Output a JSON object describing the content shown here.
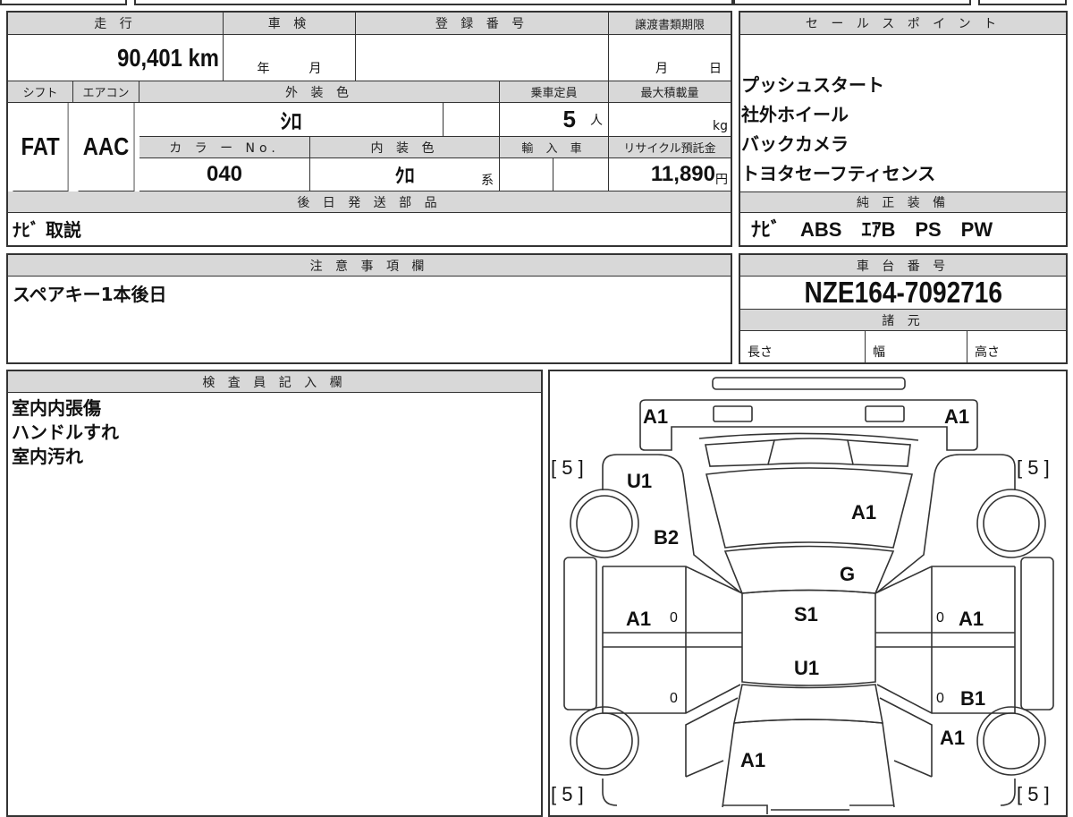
{
  "main_table": {
    "mileage_label": "走 行",
    "mileage_value": "90,401 km",
    "inspection_label": "車 検",
    "inspection_year_unit": "年",
    "inspection_month_unit": "月",
    "registration_label": "登 録 番 号",
    "transfer_deadline_label": "譲渡書類期限",
    "transfer_month_unit": "月",
    "transfer_day_unit": "日",
    "shift_label": "シフト",
    "shift_value": "FAT",
    "aircon_label": "エアコン",
    "aircon_value": "AAC",
    "exterior_color_label": "外 装 色",
    "exterior_color_value": "ｼﾛ",
    "capacity_label": "乗車定員",
    "capacity_value": "5",
    "capacity_unit": "人",
    "max_load_label": "最大積載量",
    "max_load_unit": "kg",
    "color_no_label": "カ ラ ー No.",
    "color_no_value": "040",
    "interior_color_label": "内 装 色",
    "interior_color_value": "ｸﾛ",
    "interior_color_suffix": "系",
    "import_label": "輸 入 車",
    "recycle_label": "リサイクル預託金",
    "recycle_value": "11,890",
    "recycle_unit": "円",
    "later_parts_label": "後 日 発 送 部 品",
    "later_parts_value": "ﾅﾋﾞ 取説"
  },
  "sales_points": {
    "label": "セ ー ル ス ポ イ ン ト",
    "items": [
      "プッシュスタート",
      "社外ホイール",
      "バックカメラ",
      "トヨタセーフティセンス"
    ]
  },
  "genuine_equipment": {
    "label": "純 正 装 備",
    "value": "ﾅﾋﾞ　ABS　ｴｱB　PS　PW"
  },
  "notes": {
    "label": "注 意 事 項 欄",
    "value": "スペアキー1本後日"
  },
  "chassis": {
    "label": "車 台 番 号",
    "value": "NZE164-7092716",
    "specs_label": "諸 元",
    "length_label": "長さ",
    "width_label": "幅",
    "height_label": "高さ"
  },
  "inspector": {
    "label": "検 査 員 記 入 欄",
    "lines": [
      "室内内張傷",
      "ハンドルすれ",
      "室内汚れ"
    ]
  },
  "diagram": {
    "front_left": "A1",
    "front_right": "A1",
    "tire_fl": "[ 5 ]",
    "tire_fr": "[ 5 ]",
    "tire_rl": "[ 5 ]",
    "tire_rr": "[ 5 ]",
    "left_front_fender": "U1",
    "left_fender_lower": "B2",
    "hood": "A1",
    "windshield": "G",
    "roof_front": "S1",
    "roof_rear": "U1",
    "left_front_door": "A1",
    "left_front_door_mark": "0",
    "left_rear_door_mark": "0",
    "right_front_door": "A1",
    "right_front_door_mark": "0",
    "right_rear_door_mark": "0",
    "right_rear_door": "B1",
    "right_rear_fender": "A1",
    "trunk": "A1"
  }
}
